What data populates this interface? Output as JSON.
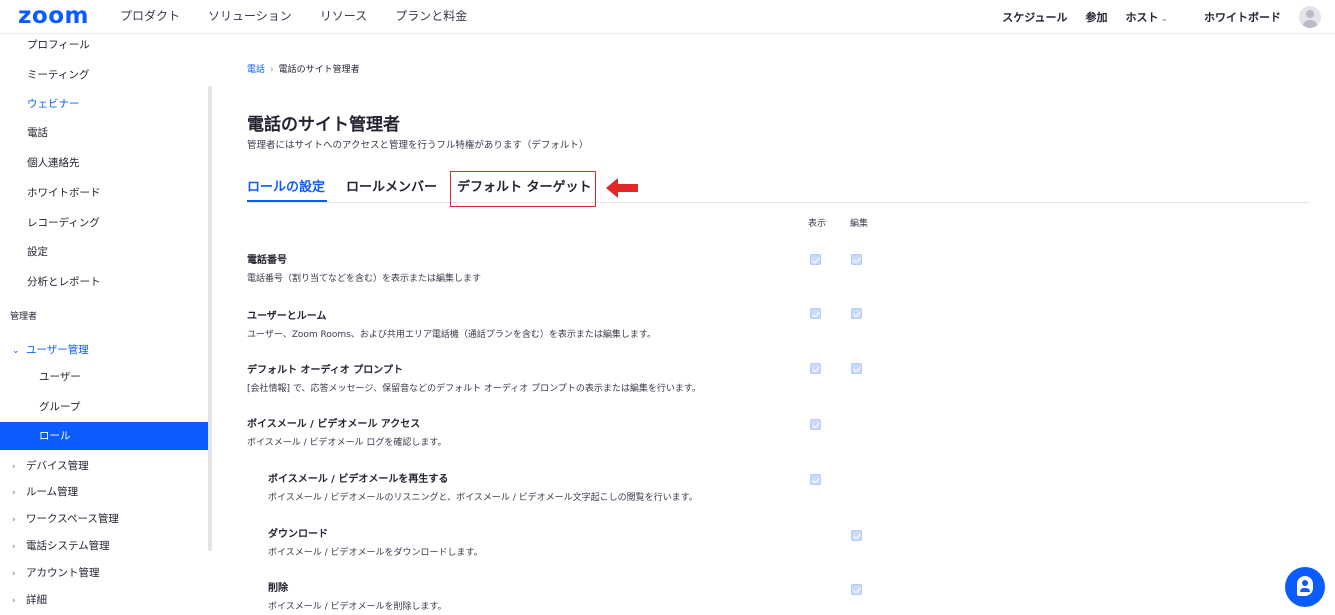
{
  "topnav": {
    "logo": "zoom",
    "left": [
      "プロダクト",
      "ソリューション",
      "リソース",
      "プランと料金"
    ],
    "schedule": "スケジュール",
    "join": "参加",
    "host": "ホスト",
    "whiteboard": "ホワイトボード"
  },
  "sidebar": {
    "profile": "プロフィール",
    "meeting": "ミーティング",
    "webinar": "ウェビナー",
    "phone": "電話",
    "contacts": "個人連絡先",
    "whiteboard": "ホワイトボード",
    "recording": "レコーディング",
    "settings": "設定",
    "analytics": "分析とレポート",
    "admin_section": "管理者",
    "user_mgmt": "ユーザー管理",
    "users": "ユーザー",
    "groups": "グループ",
    "roles": "ロール",
    "device_mgmt": "デバイス管理",
    "room_mgmt": "ルーム管理",
    "workspace_mgmt": "ワークスペース管理",
    "phone_system_mgmt": "電話システム管理",
    "account_mgmt": "アカウント管理",
    "advanced": "詳細"
  },
  "breadcrumb": {
    "parent": "電話",
    "current": "電話のサイト管理者"
  },
  "page": {
    "title": "電話のサイト管理者",
    "description": "管理者にはサイトへのアクセスと管理を行うフル特権があります（デフォルト）"
  },
  "tabs": {
    "role_settings": "ロールの設定",
    "role_members": "ロールメンバー",
    "default_target": "デフォルト ターゲット"
  },
  "columns": {
    "view": "表示",
    "edit": "編集"
  },
  "permissions": [
    {
      "title": "電話番号",
      "desc": "電話番号（割り当てなどを含む）を表示または編集します",
      "view": true,
      "edit": true
    },
    {
      "title": "ユーザーとルーム",
      "desc": "ユーザー、Zoom Rooms、および共用エリア電話機（通話プランを含む）を表示または編集します。",
      "view": true,
      "edit": true
    },
    {
      "title": "デフォルト オーディオ プロンプト",
      "desc": "[会社情報] で、応答メッセージ、保留音などのデフォルト オーディオ プロンプトの表示または編集を行います。",
      "view": true,
      "edit": true
    },
    {
      "title": "ボイスメール / ビデオメール アクセス",
      "desc": "ボイスメール / ビデオメール ログを確認します。",
      "view": true,
      "edit": false
    },
    {
      "title": "ボイスメール / ビデオメールを再生する",
      "desc": "ボイスメール / ビデオメールのリスニングと、ボイスメール / ビデオメール文字起こしの閲覧を行います。",
      "view": true,
      "edit": false
    },
    {
      "title": "ダウンロード",
      "desc": "ボイスメール / ビデオメールをダウンロードします。",
      "view": false,
      "edit": true
    },
    {
      "title": "削除",
      "desc": "ボイスメール / ビデオメールを削除します。",
      "view": false,
      "edit": true
    }
  ],
  "colors": {
    "brand": "#0b5cff",
    "highlight": "#e02828",
    "checkbox_disabled": "#c9dbff"
  }
}
